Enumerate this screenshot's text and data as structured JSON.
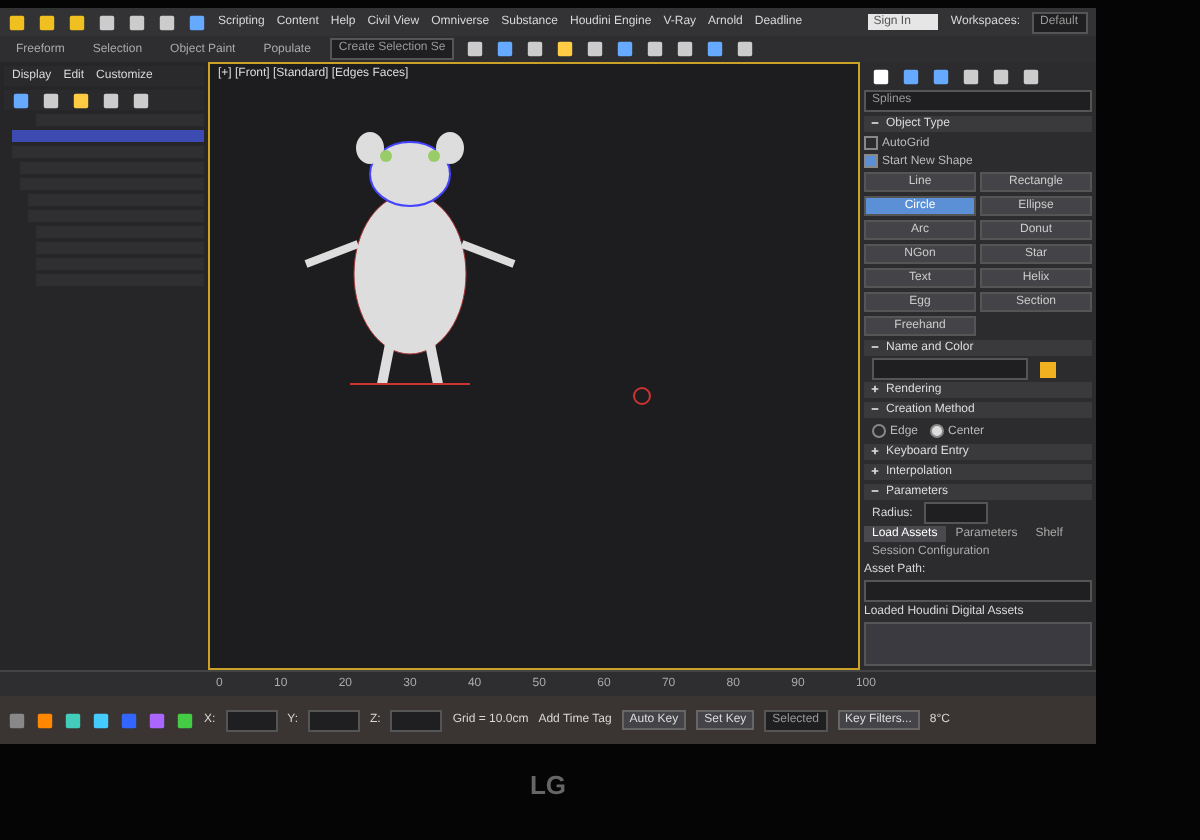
{
  "menu_bar": {
    "items": [
      "Scripting",
      "Content",
      "Help",
      "Civil View",
      "Omniverse",
      "Substance",
      "Houdini Engine",
      "V-Ray",
      "Arnold",
      "Deadline"
    ],
    "sign_in": "Sign In",
    "workspace_label": "Workspaces:",
    "workspace": "Default"
  },
  "ribbon_tabs": [
    {
      "label": "Freeform",
      "selected": false
    },
    {
      "label": "Selection",
      "selected": false
    },
    {
      "label": "Object Paint",
      "selected": false
    },
    {
      "label": "Populate",
      "selected": false
    }
  ],
  "selection_set": {
    "placeholder": "Create Selection Se"
  },
  "scene_explorer": {
    "menu": [
      "Display",
      "Edit",
      "Customize"
    ],
    "rows": [
      {
        "selected": false
      },
      {
        "selected": true
      },
      {
        "selected": false
      },
      {
        "selected": false
      },
      {
        "selected": false
      },
      {
        "selected": false
      },
      {
        "selected": false
      },
      {
        "selected": false
      },
      {
        "selected": false
      },
      {
        "selected": false
      },
      {
        "selected": false
      }
    ]
  },
  "viewport": {
    "label": "[+] [Front] [Standard] [Edges Faces]"
  },
  "command_panel": {
    "category": "Splines",
    "rollouts": [
      {
        "title": "Object Type",
        "expanded": true
      },
      {
        "title": "Name and Color",
        "expanded": true
      },
      {
        "title": "Rendering",
        "expanded": false
      },
      {
        "title": "Creation Method",
        "expanded": true
      },
      {
        "title": "Keyboard Entry",
        "expanded": false
      },
      {
        "title": "Interpolation",
        "expanded": false
      },
      {
        "title": "Parameters",
        "expanded": true
      }
    ],
    "options": [
      {
        "label": "AutoGrid",
        "checked": false
      },
      {
        "label": "Start New Shape",
        "checked": true
      }
    ],
    "object_types": [
      {
        "label": "Line",
        "selected": false
      },
      {
        "label": "Rectangle",
        "selected": false
      },
      {
        "label": "Circle",
        "selected": true
      },
      {
        "label": "Ellipse",
        "selected": false
      },
      {
        "label": "Arc",
        "selected": false
      },
      {
        "label": "Donut",
        "selected": false
      },
      {
        "label": "NGon",
        "selected": false
      },
      {
        "label": "Star",
        "selected": false
      },
      {
        "label": "Text",
        "selected": false
      },
      {
        "label": "Helix",
        "selected": false
      },
      {
        "label": "Egg",
        "selected": false
      },
      {
        "label": "Section",
        "selected": false
      },
      {
        "label": "Freehand",
        "selected": false
      }
    ],
    "creation_methods": [
      {
        "label": "Edge",
        "selected": false
      },
      {
        "label": "Center",
        "selected": true
      }
    ],
    "radius_label": "Radius:"
  },
  "houdini_panel": {
    "tabs": [
      {
        "label": "Load Assets",
        "selected": true
      },
      {
        "label": "Parameters",
        "selected": false
      },
      {
        "label": "Shelf",
        "selected": false
      },
      {
        "label": "Session Configuration",
        "selected": false
      }
    ],
    "asset_path_label": "Asset Path:",
    "loaded_label": "Loaded Houdini Digital Assets"
  },
  "timeline": {
    "ticks": [
      "0",
      "10",
      "20",
      "30",
      "40",
      "50",
      "60",
      "70",
      "80",
      "90",
      "100"
    ]
  },
  "status_bar": {
    "coords": [
      "X:",
      "Y:",
      "Z:"
    ],
    "grid": "Grid = 10.0cm",
    "time_tag": "Add Time Tag",
    "auto_key": "Auto Key",
    "set_key": "Set Key",
    "key_mode": "Selected",
    "key_filters": "Key Filters...",
    "weather": "8°C"
  },
  "monitor": {
    "brand": "LG"
  }
}
